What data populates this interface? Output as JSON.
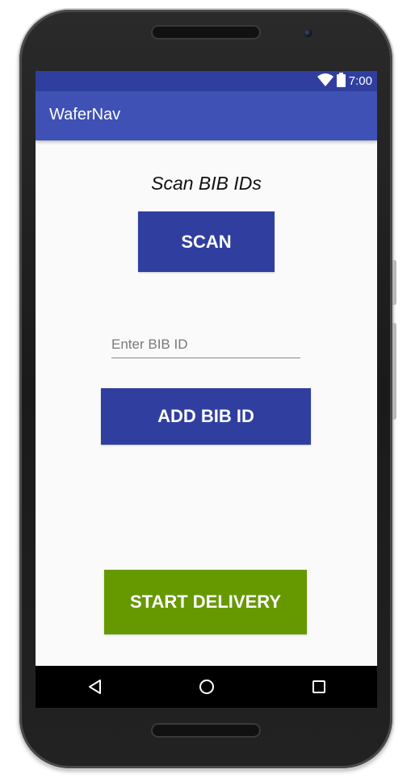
{
  "status_bar": {
    "time": "7:00",
    "icons": [
      "wifi-icon",
      "battery-icon"
    ]
  },
  "app_bar": {
    "title": "WaferNav"
  },
  "main": {
    "scan_label": "Scan BIB IDs",
    "scan_button": "SCAN",
    "bib_input": {
      "value": "",
      "placeholder": "Enter BIB ID"
    },
    "add_button": "ADD BIB ID",
    "start_button": "START DELIVERY"
  },
  "nav_bar": {
    "icons": [
      "back-icon",
      "home-icon",
      "recents-icon"
    ]
  },
  "colors": {
    "status_bar": "#303f9f",
    "app_bar": "#3f51b5",
    "primary_button": "#303f9f",
    "start_button": "#669900",
    "background": "#fafafa"
  }
}
